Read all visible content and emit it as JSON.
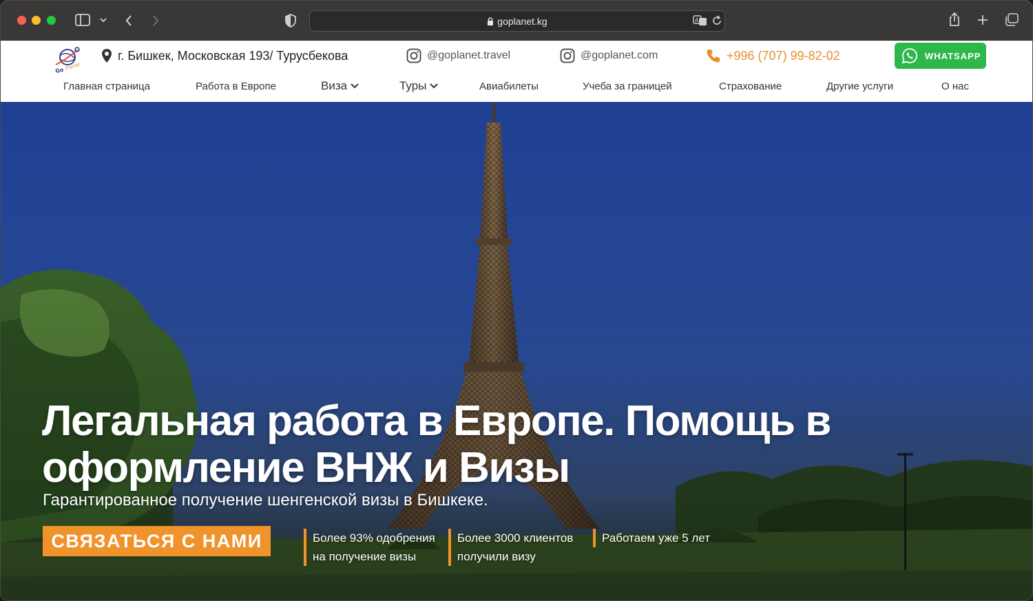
{
  "browser": {
    "url": "goplanet.kg"
  },
  "header": {
    "address": "г. Бишкек, Московская 193/ Турусбекова",
    "instagram_1": "@goplanet.travel",
    "instagram_2": "@goplanet.com",
    "phone": "+996 (707) 99-82-02",
    "whatsapp_label": "WHATSAPP"
  },
  "nav": {
    "items": [
      {
        "label": "Главная страница"
      },
      {
        "label": "Работа в Европе"
      },
      {
        "label": "Виза"
      },
      {
        "label": "Туры"
      },
      {
        "label": "Авиабилеты"
      },
      {
        "label": "Учеба за границей"
      },
      {
        "label": "Страхование"
      },
      {
        "label": "Другие услуги"
      },
      {
        "label": "О нас"
      }
    ]
  },
  "hero": {
    "title_line1": "Легальная работа в Европе. Помощь в",
    "title_line2": "оформление ВНЖ и Визы",
    "subtitle": "Гарантированное получение шенгенской визы в Бишкеке.",
    "cta_label": "СВЯЗАТЬСЯ С НАМИ",
    "stats": [
      {
        "line1": "Более 93% одобрения",
        "line2": "на получение визы"
      },
      {
        "line1": "Более 3000 клиентов",
        "line2": "получили визу"
      },
      {
        "line1": "Работаем уже 5 лет",
        "line2": ""
      }
    ]
  },
  "colors": {
    "accent_orange": "#f0932b",
    "whatsapp_green": "#2eb84c",
    "phone_orange": "#e58f2f"
  }
}
